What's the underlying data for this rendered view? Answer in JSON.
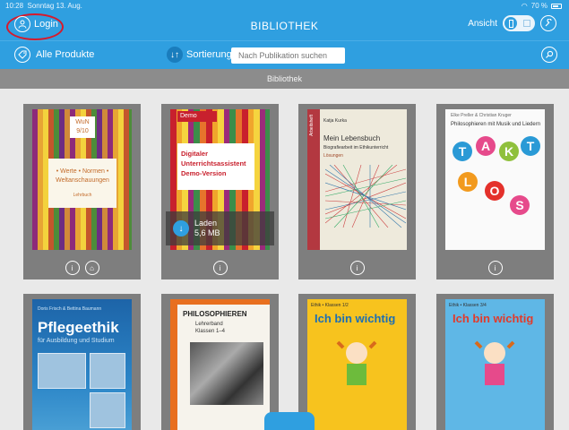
{
  "status": {
    "time": "10:28",
    "date": "Sonntag 13. Aug.",
    "battery": "70 %"
  },
  "header": {
    "login_label": "Login",
    "title": "BIBLIOTHEK",
    "view_label": "Ansicht"
  },
  "toolbar": {
    "all_products_label": "Alle Produkte",
    "sort_label": "Sortierung",
    "search_placeholder": "Nach Publikation suchen"
  },
  "section": {
    "title": "Bibliothek"
  },
  "books": [
    {
      "cover": {
        "badge_line1": "WuN",
        "badge_line2": "9/10",
        "title": "• Werte • Normen • Weltanschauungen",
        "subtitle": "Lehrbuch"
      }
    },
    {
      "cover": {
        "label": "Demo",
        "title": "Digitaler Unterrichtsassistent Demo-Version"
      },
      "download": {
        "label": "Laden",
        "size": "5,6 MB"
      }
    },
    {
      "cover": {
        "spine": "Arbeitsheft",
        "author": "Katja Kurka",
        "title": "Mein Lebensbuch",
        "subtitle": "Biografiearbeit im Ethikunterricht",
        "note": "Lösungen"
      }
    },
    {
      "cover": {
        "authors": "Elke Preller & Christian Kruger",
        "title": "Philosophieren mit Musik und Liedern",
        "letters": [
          "T",
          "A",
          "K",
          "T",
          "L",
          "O",
          "S"
        ]
      }
    },
    {
      "cover": {
        "authors": "Doris Frisch & Bettina Baumann",
        "title": "Pflegeethik",
        "subtitle": "für Ausbildung und Studium"
      }
    },
    {
      "cover": {
        "title": "PHILOSOPHIEREN",
        "subtitle_line1": "Lehrerband",
        "subtitle_line2": "Klassen 1–4"
      }
    },
    {
      "cover": {
        "top": "Ethik • Klassen 1/2",
        "title": "Ich bin wichtig"
      }
    },
    {
      "cover": {
        "top": "Ethik • Klassen 3/4",
        "title": "Ich bin wichtig"
      }
    }
  ],
  "colors": {
    "primary": "#2f9fe0",
    "highlight_ring": "#d61a2c",
    "section_bar": "#8c8c8c",
    "card": "#7e7e7e"
  }
}
